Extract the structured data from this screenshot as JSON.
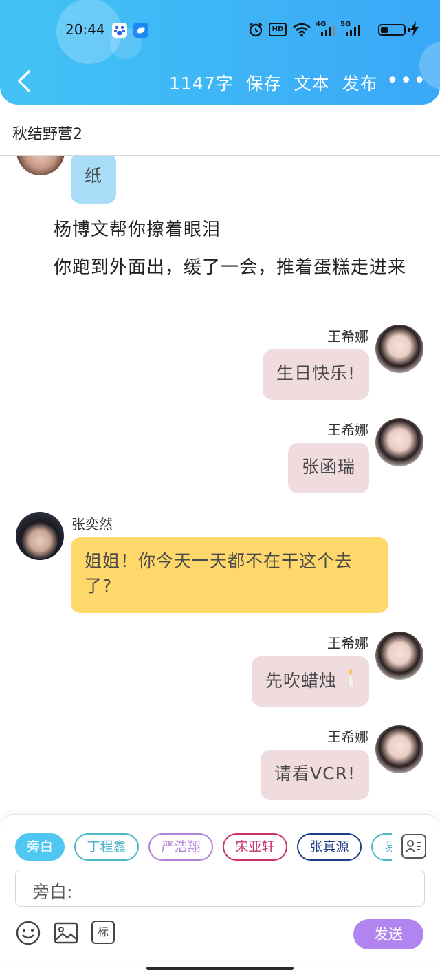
{
  "status_bar": {
    "time": "20:44",
    "icons": [
      "baidu-paw-icon",
      "app-blue-icon",
      "alarm-icon",
      "hd-icon",
      "wifi-icon",
      "4g-signal-icon",
      "5g-signal-icon",
      "battery-icon",
      "charging-bolt-icon"
    ],
    "hd_label": "HD",
    "net1": "4G",
    "net2": "5G",
    "battery_level": 0.3
  },
  "header": {
    "back_icon": "chevron-left-icon",
    "word_count": "1147字",
    "save_label": "保存",
    "text_label": "文本",
    "publish_label": "发布",
    "more_label": "•••",
    "colors": {
      "gradient_start": "#42c3f5",
      "gradient_end": "#3aa8f7"
    }
  },
  "doc": {
    "title": "秋结野营2"
  },
  "messages": {
    "partial_bubble": {
      "text": "纸",
      "color": "#a9dcf6"
    },
    "narration_1": "杨博文帮你擦着眼泪",
    "narration_2": "你跑到外面出，缓了一会，推着蛋糕走进来",
    "m1": {
      "sender": "王希娜",
      "text": "生日快乐!",
      "color": "#f0dcdf"
    },
    "m2": {
      "sender": "王希娜",
      "text": "张函瑞",
      "color": "#f0dcdf"
    },
    "m3": {
      "sender": "张奕然",
      "text": "姐姐！你今天一天都不在干这个去了?",
      "color": "#fed86a"
    },
    "m4": {
      "sender": "王希娜",
      "text": "先吹蜡烛",
      "emoji": "candle-icon",
      "color": "#f0dcdf"
    },
    "m5": {
      "sender": "王希娜",
      "text": "请看VCR!",
      "color": "#f0dcdf"
    }
  },
  "composer": {
    "chips": [
      {
        "label": "旁白",
        "color": "#4fc7f0",
        "selected": true
      },
      {
        "label": "丁程鑫",
        "color": "#4db6c9",
        "selected": false
      },
      {
        "label": "严浩翔",
        "color": "#b07fd6",
        "selected": false
      },
      {
        "label": "宋亚轩",
        "color": "#c8306e",
        "selected": false
      },
      {
        "label": "张真源",
        "color": "#1f3d85",
        "selected": false
      },
      {
        "label": "易",
        "color": "#4db6c9",
        "selected": false
      }
    ],
    "contacts_icon": "contacts-card-icon",
    "input_label": "旁白:",
    "tools": [
      "emoji-icon",
      "image-icon",
      "tag-icon"
    ],
    "tag_label": "标",
    "send_label": "发送",
    "send_color": "#b184ef"
  }
}
